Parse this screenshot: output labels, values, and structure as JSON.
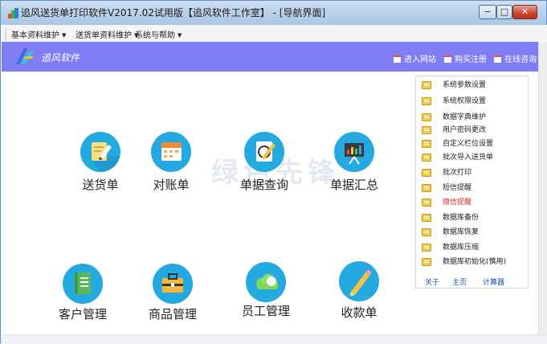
{
  "window": {
    "title": "追风送货单打印软件V2017.02试用版【追风软件工作室】 - [导航界面]",
    "controls": [
      "−",
      "□",
      "✕"
    ]
  },
  "menubar": {
    "items": [
      {
        "label": "基本资料维护"
      },
      {
        "label": "送货单资料维护"
      },
      {
        "label": "系统与帮助"
      }
    ]
  },
  "banner": {
    "brand": "追风软件",
    "links": [
      {
        "label": "进入网站"
      },
      {
        "label": "购买注册"
      },
      {
        "label": "在线咨询"
      }
    ]
  },
  "watermark": "绿色先锋",
  "tiles": [
    {
      "label": "送货单",
      "icon": "pencil-note-icon",
      "color": "#24a9e0"
    },
    {
      "label": "对账单",
      "icon": "calendar-icon",
      "color": "#24a9e0"
    },
    {
      "label": "单据查询",
      "icon": "refresh-document-icon",
      "color": "#24a9e0"
    },
    {
      "label": "单据汇总",
      "icon": "presentation-chart-icon",
      "color": "#24a9e0"
    },
    {
      "label": "客户管理",
      "icon": "address-book-icon",
      "color": "#24a9e0"
    },
    {
      "label": "商品管理",
      "icon": "briefcase-icon",
      "color": "#24a9e0"
    },
    {
      "label": "员工管理",
      "icon": "cloud-icon",
      "color": "#24a9e0"
    },
    {
      "label": "收款单",
      "icon": "pencil-icon",
      "color": "#24a9e0"
    }
  ],
  "panel": {
    "items": [
      {
        "label": "系统参数设置"
      },
      {
        "label": "系统权限设置"
      },
      {
        "label": "数据字典维护"
      },
      {
        "label": "用户密码更改"
      },
      {
        "label": "自定义栏位设置"
      },
      {
        "label": "批次导入送货单"
      },
      {
        "label": "批次打印"
      },
      {
        "label": "短信提醒"
      },
      {
        "label": "微信提醒"
      },
      {
        "label": "数据库备份"
      },
      {
        "label": "数据库恢复"
      },
      {
        "label": "数据库压缩"
      },
      {
        "label": "数据库初始化(慎用)"
      }
    ],
    "footer": [
      {
        "label": "关于"
      },
      {
        "label": "主页"
      },
      {
        "label": "计算器"
      }
    ]
  },
  "colors": {
    "banner": "#7e7df3",
    "tile_circle": "#24a9e0",
    "highlight_text": "#d0302c",
    "footer_link": "#1d4fb6"
  }
}
